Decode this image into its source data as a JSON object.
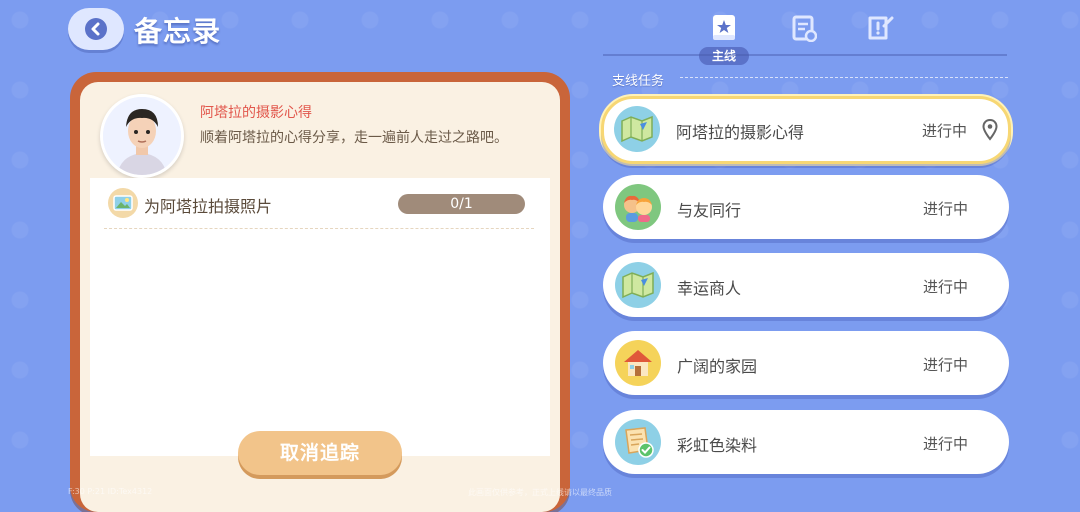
{
  "header": {
    "title": "备忘录"
  },
  "detail": {
    "quest_name": "阿塔拉的摄影心得",
    "quest_desc": "顺着阿塔拉的心得分享，走一遍前人走过之路吧。",
    "tasks": [
      {
        "label": "为阿塔拉拍摄照片",
        "progress_text": "0/1",
        "progress": 0
      }
    ],
    "cancel_label": "取消追踪"
  },
  "tabs": {
    "main_label": "主线",
    "icons": [
      "star-book-icon",
      "clipboard-icon",
      "wish-note-icon"
    ]
  },
  "section_label": "支线任务",
  "quests": [
    {
      "title": "阿塔拉的摄影心得",
      "status": "进行中",
      "icon": "map-icon",
      "tracked": true
    },
    {
      "title": "与友同行",
      "status": "进行中",
      "icon": "friends-icon",
      "tracked": false
    },
    {
      "title": "幸运商人",
      "status": "进行中",
      "icon": "map-icon",
      "tracked": false
    },
    {
      "title": "广阔的家园",
      "status": "进行中",
      "icon": "house-icon",
      "tracked": false
    },
    {
      "title": "彩虹色染料",
      "status": "进行中",
      "icon": "dye-list-icon",
      "tracked": false
    }
  ],
  "footer": {
    "left": "F:30  P:21  ID:Tex4312",
    "mid": "此画面仅供参考，正式上线请以最终品质"
  },
  "colors": {
    "background": "#7c9cf0",
    "panel_frame": "#c9653a",
    "accent_red": "#e2574c",
    "button": "#f2c48a",
    "active_border": "#f7d774"
  }
}
